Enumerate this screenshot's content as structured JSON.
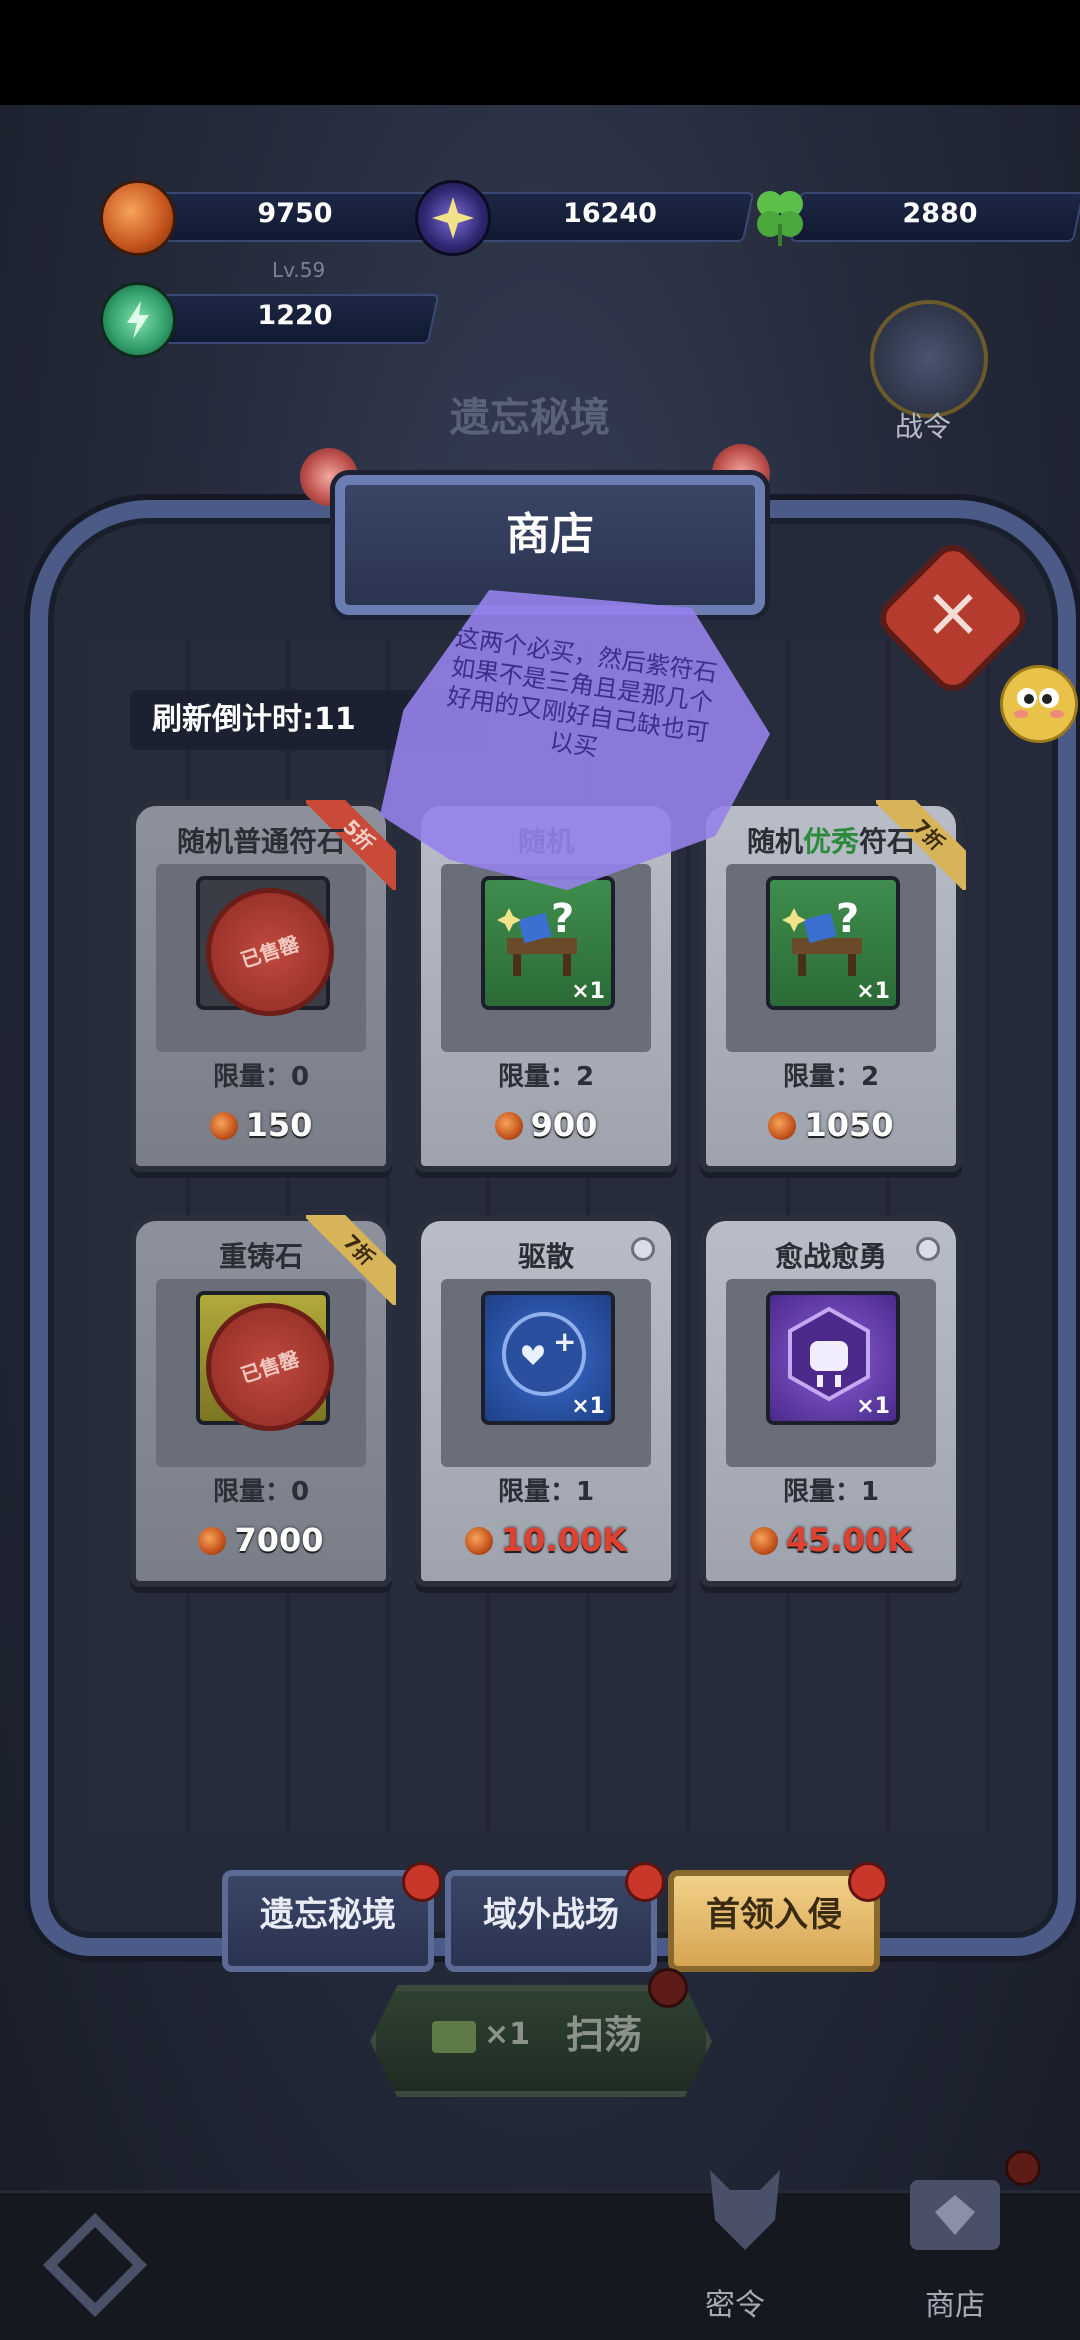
{
  "currencies": [
    {
      "icon": "pumpkin-icon",
      "value": "9750"
    },
    {
      "icon": "purple-star-icon",
      "value": "16240"
    },
    {
      "icon": "clover-icon",
      "value": "2880"
    },
    {
      "icon": "energy-icon",
      "value": "1220"
    }
  ],
  "player": {
    "level": "Lv.59"
  },
  "background": {
    "title": "遗忘秘境",
    "battle_pass_label": "战令"
  },
  "shop": {
    "title": "商店",
    "timer_label": "刷新倒计时:11",
    "note": "这两个必买，然后紫符石如果不是三角且是那几个好用的又刚好自己缺也可以买",
    "cards": [
      {
        "name": "随机普通符石",
        "limit": "限量：0",
        "price": "150",
        "ribbon": "5折",
        "sold_label": "已售罄"
      },
      {
        "name": "随机",
        "limit": "限量：2",
        "price": "900",
        "qty": "×1"
      },
      {
        "name_prefix": "随机",
        "name_highlight": "优秀",
        "name_suffix": "符石",
        "limit": "限量：2",
        "price": "1050",
        "ribbon": "7折",
        "qty": "×1"
      },
      {
        "name": "重铸石",
        "limit": "限量：0",
        "price": "7000",
        "ribbon": "7折",
        "sold_label": "已售罄"
      },
      {
        "name": "驱散",
        "limit": "限量：1",
        "price": "10.00K",
        "qty": "×1"
      },
      {
        "name": "愈战愈勇",
        "limit": "限量：1",
        "price": "45.00K",
        "qty": "×1"
      }
    ]
  },
  "tabs": [
    {
      "label": "遗忘秘境"
    },
    {
      "label": "域外战场"
    },
    {
      "label": "首领入侵"
    }
  ],
  "sweep": {
    "count": "×1",
    "label": "扫荡"
  },
  "bottom_nav": [
    {
      "label": "密令",
      "icon": "wolf-skull-icon"
    },
    {
      "label": "商店",
      "icon": "shop-chest-icon"
    }
  ],
  "colors": {
    "accent_gold": "#d5a553",
    "frame_blue": "#4b5a86",
    "price_red": "#e0402f",
    "highlight_green": "#2b8a3b"
  }
}
